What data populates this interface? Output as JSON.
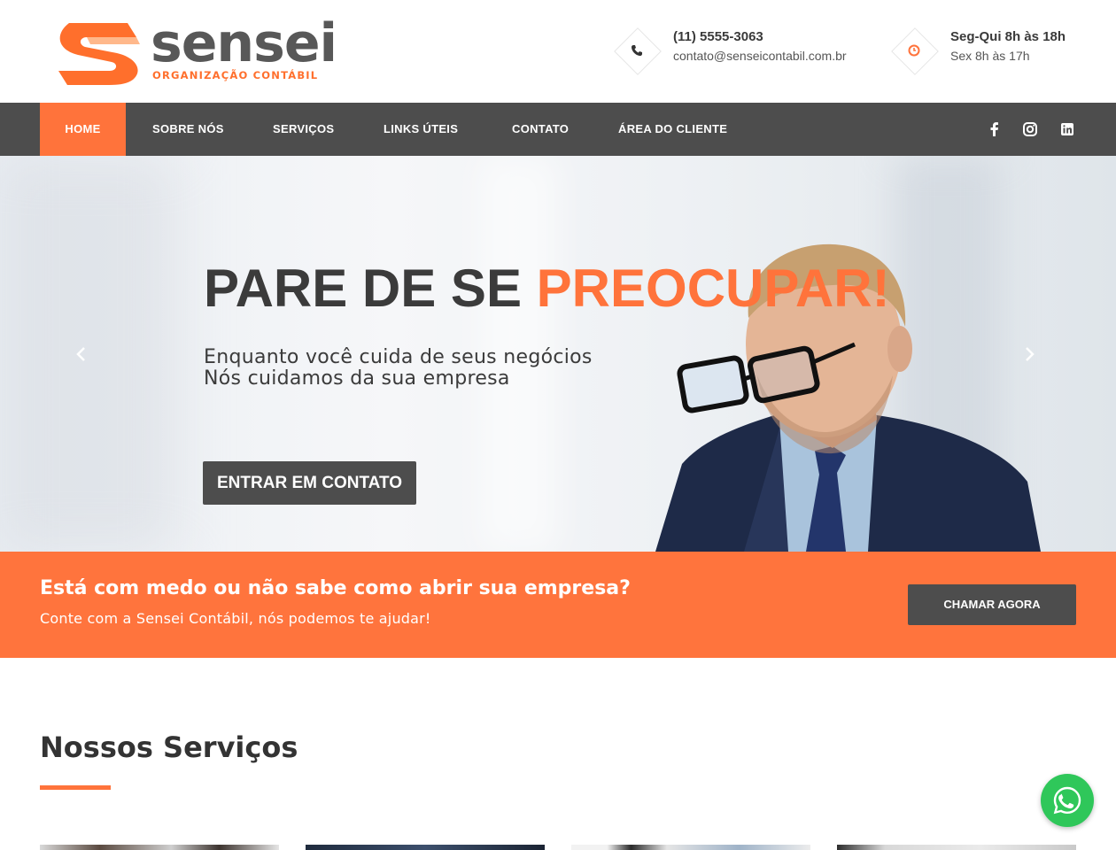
{
  "brand": {
    "wordmark": "sensei",
    "tagline": "ORGANIZAÇÃO CONTÁBIL",
    "logo_colors": {
      "orange": "#ff6f2c",
      "gray": "#585858"
    }
  },
  "header": {
    "phone": {
      "icon": "phone-icon",
      "number": "(11) 5555-3063",
      "email": "contato@senseicontabil.com.br"
    },
    "hours": {
      "icon": "clock-icon",
      "weekdays": "Seg-Qui 8h às 18h",
      "friday": "Sex 8h às 17h"
    }
  },
  "nav": {
    "items": [
      {
        "label": "HOME",
        "active": true
      },
      {
        "label": "SOBRE NÓS",
        "active": false
      },
      {
        "label": "SERVIÇOS",
        "active": false
      },
      {
        "label": "LINKS ÚTEIS",
        "active": false
      },
      {
        "label": "CONTATO",
        "active": false
      },
      {
        "label": "ÁREA DO CLIENTE",
        "active": false
      }
    ],
    "social": [
      "facebook-icon",
      "instagram-icon",
      "linkedin-icon"
    ]
  },
  "hero": {
    "headline_dark": "PARE DE SE ",
    "headline_accent": "PREOCUPAR!",
    "sub_line1": "Enquanto você cuida de seus negócios",
    "sub_line2": "Nós cuidamos da sua empresa",
    "cta_label": "ENTRAR EM CONTATO",
    "prev_icon": "chevron-left-icon",
    "next_icon": "chevron-right-icon"
  },
  "banner": {
    "title": "Está com medo ou não sabe como abrir sua empresa?",
    "subtitle": "Conte com a Sensei Contábil, nós podemos te ajudar!",
    "button_label": "CHAMAR AGORA"
  },
  "services": {
    "title": "Nossos Serviços"
  },
  "whatsapp": {
    "icon": "whatsapp-icon"
  },
  "colors": {
    "accent": "#ff733b",
    "nav_bg": "#4d4d4d",
    "banner_bg": "#ff743d",
    "whatsapp_green": "#2fc75a"
  }
}
